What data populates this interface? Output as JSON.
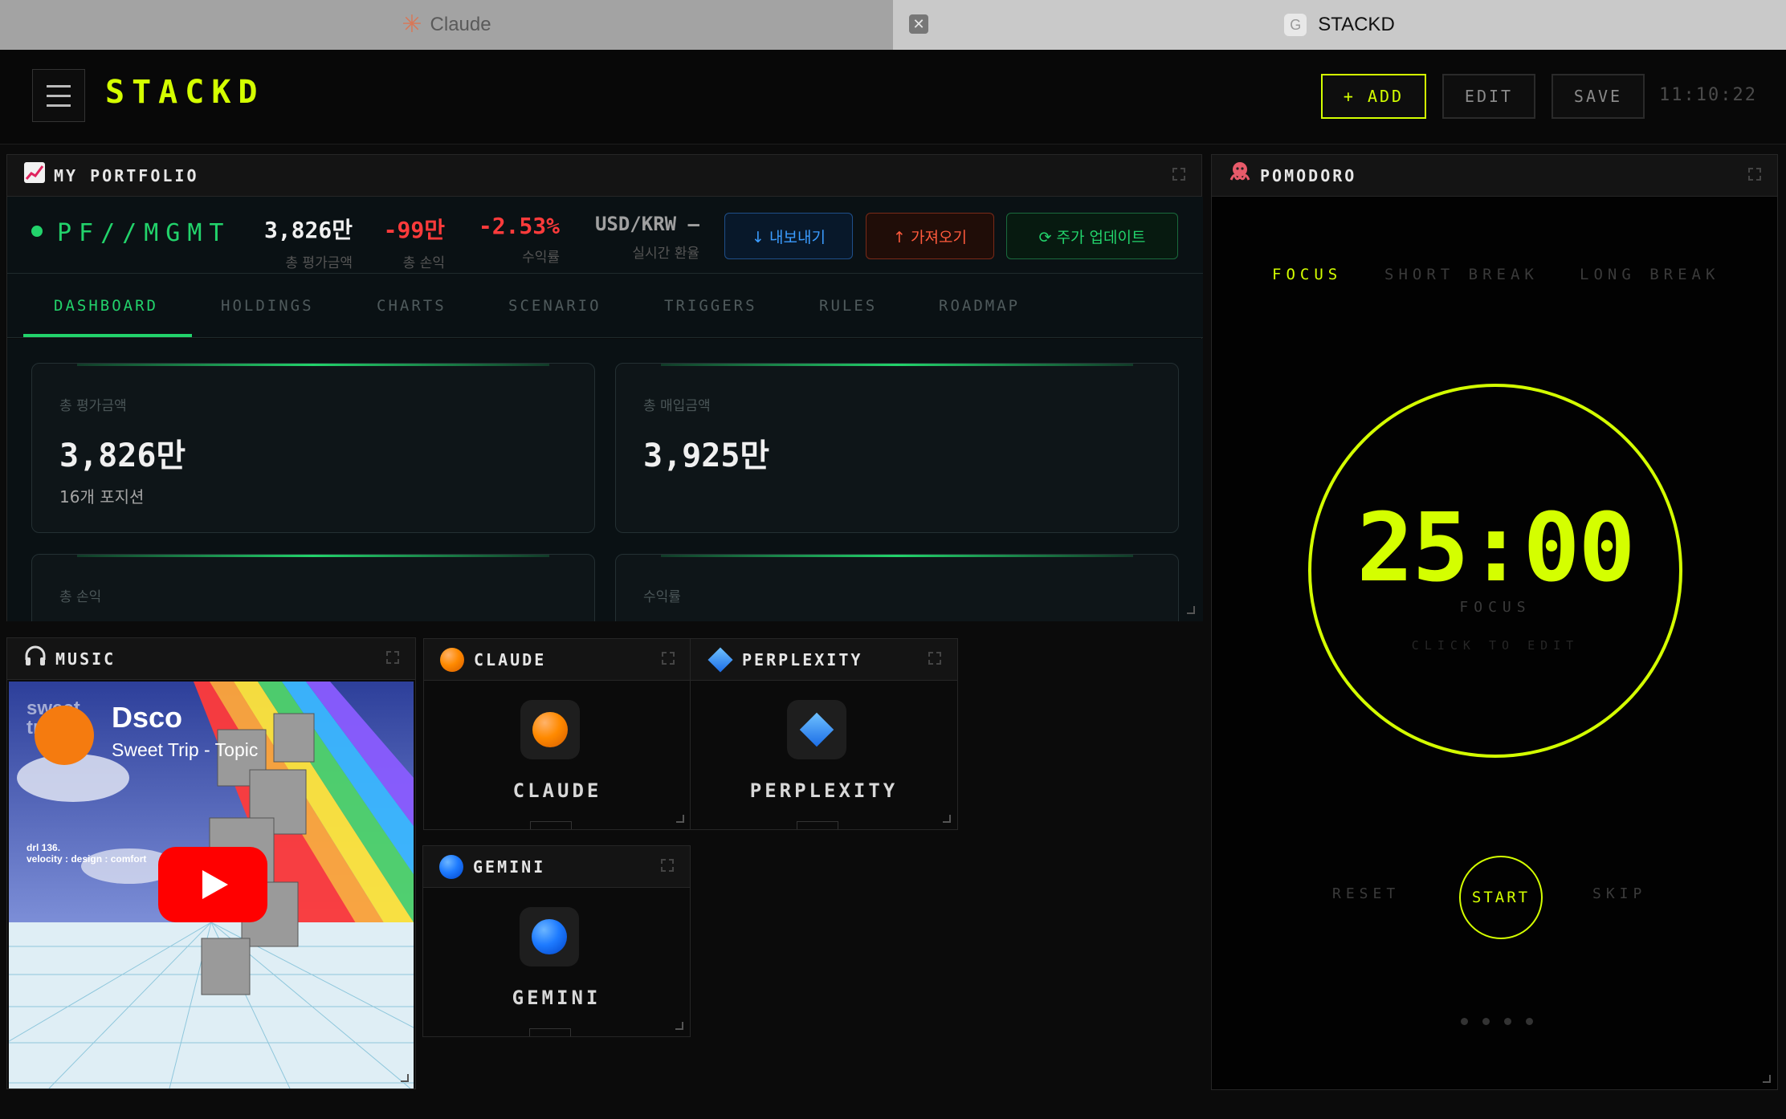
{
  "browser": {
    "tabs": [
      {
        "label": "Claude",
        "icon": "claude-starburst-icon"
      },
      {
        "label": "STACKD",
        "icon": "g-favicon-icon"
      }
    ]
  },
  "header": {
    "logo": "STACKD",
    "add_label": "+ ADD",
    "edit_label": "EDIT",
    "save_label": "SAVE",
    "clock": "11:10:22",
    "accent": "#d4ff00"
  },
  "portfolio": {
    "title": "MY PORTFOLIO",
    "icon": "chart-up-icon",
    "name": "PF//MGMT",
    "stats": [
      {
        "value": "3,826만",
        "label": "총 평가금액",
        "color": "#f0f0f0"
      },
      {
        "value": "-99만",
        "label": "총 손익",
        "color": "#ff3b3b"
      },
      {
        "value": "-2.53%",
        "label": "수익률",
        "color": "#ff3b3b"
      },
      {
        "value": "USD/KRW —",
        "label": "실시간 환율",
        "color": "#a0a0a0"
      }
    ],
    "export_label": "↓ 내보내기",
    "import_label": "↑ 가져오기",
    "update_label": "⟳ 주가 업데이트",
    "tabs": [
      "DASHBOARD",
      "HOLDINGS",
      "CHARTS",
      "SCENARIO",
      "TRIGGERS",
      "RULES",
      "ROADMAP"
    ],
    "active_tab": "DASHBOARD",
    "cards": [
      {
        "label": "총 평가금액",
        "value": "3,826만",
        "sub": "16개 포지션"
      },
      {
        "label": "총 매입금액",
        "value": "3,925만",
        "sub": ""
      },
      {
        "label": "총 손익",
        "value": "",
        "sub": ""
      },
      {
        "label": "수익률",
        "value": "",
        "sub": ""
      }
    ],
    "accent": "#22d36b"
  },
  "pomodoro": {
    "title": "POMODORO",
    "icon": "octopus-icon",
    "modes": [
      "FOCUS",
      "SHORT BREAK",
      "LONG BREAK"
    ],
    "active_mode": "FOCUS",
    "time": "25:00",
    "label": "FOCUS",
    "hint": "CLICK TO EDIT",
    "reset_label": "RESET",
    "start_label": "START",
    "skip_label": "SKIP",
    "sessions": 4
  },
  "music": {
    "title": "MUSIC",
    "icon": "headphones-icon",
    "video_title": "Dsco",
    "channel": "Sweet Trip - Topic",
    "caption_lines": [
      "drl 136.",
      "velocity : design : comfort"
    ],
    "corner_text": [
      "sweet",
      "trip"
    ]
  },
  "ai_widgets": [
    {
      "title": "CLAUDE",
      "label": "CLAUDE",
      "icon": "orange-orb-icon"
    },
    {
      "title": "PERPLEXITY",
      "label": "PERPLEXITY",
      "icon": "blue-diamond-icon"
    },
    {
      "title": "GEMINI",
      "label": "GEMINI",
      "icon": "blue-orb-icon"
    }
  ]
}
